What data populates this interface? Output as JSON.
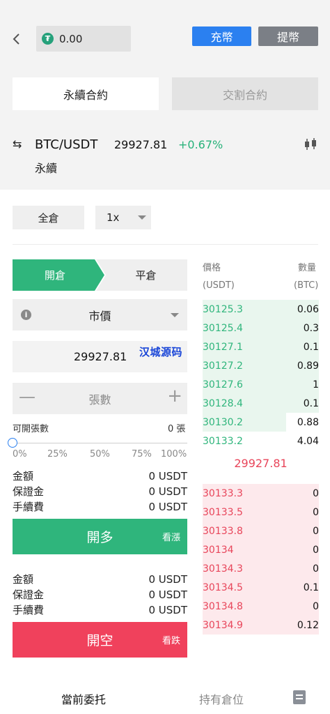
{
  "header": {
    "balance": "0.00",
    "deposit_label": "充幣",
    "withdraw_label": "提幣"
  },
  "contract_tabs": {
    "perpetual": "永續合約",
    "delivery": "交割合約"
  },
  "ticker": {
    "pair": "BTC/USDT",
    "price": "29927.81",
    "change": "+0.67%",
    "sub": "永續"
  },
  "margin": {
    "mode": "全倉",
    "leverage": "1x"
  },
  "order_form": {
    "open_label": "開倉",
    "close_label": "平倉",
    "order_type": "市價",
    "price_value": "29927.81",
    "watermark": "汉城源码",
    "qty_placeholder": "張數",
    "available_label": "可開張數",
    "available_value": "0 張",
    "slider_value": 0,
    "percent_marks": [
      "0%",
      "25%",
      "50%",
      "75%",
      "100%"
    ],
    "long_summary": [
      {
        "label": "金額",
        "value": "0 USDT"
      },
      {
        "label": "保證金",
        "value": "0 USDT"
      },
      {
        "label": "手續費",
        "value": "0 USDT"
      }
    ],
    "long_button": "開多",
    "long_sub": "看漲",
    "short_summary": [
      {
        "label": "金額",
        "value": "0 USDT"
      },
      {
        "label": "保證金",
        "value": "0 USDT"
      },
      {
        "label": "手續費",
        "value": "0 USDT"
      }
    ],
    "short_button": "開空",
    "short_sub": "看跌"
  },
  "orderbook": {
    "price_header": "價格",
    "price_unit": "(USDT)",
    "qty_header": "數量",
    "qty_unit": "(BTC)",
    "bids": [
      {
        "price": "30125.3",
        "qty": "0.06",
        "depth": 1.0
      },
      {
        "price": "30125.4",
        "qty": "0.3",
        "depth": 1.0
      },
      {
        "price": "30127.1",
        "qty": "0.1",
        "depth": 1.0
      },
      {
        "price": "30127.2",
        "qty": "0.89",
        "depth": 1.0
      },
      {
        "price": "30127.6",
        "qty": "1",
        "depth": 1.0
      },
      {
        "price": "30128.4",
        "qty": "0.1",
        "depth": 1.0
      },
      {
        "price": "30130.2",
        "qty": "0.88",
        "depth": 0.72
      },
      {
        "price": "30133.2",
        "qty": "4.04",
        "depth": 0
      }
    ],
    "mid_price": "29927.81",
    "asks": [
      {
        "price": "30133.3",
        "qty": "0",
        "depth": 1.0
      },
      {
        "price": "30133.5",
        "qty": "0",
        "depth": 1.0
      },
      {
        "price": "30133.8",
        "qty": "0",
        "depth": 1.0
      },
      {
        "price": "30134",
        "qty": "0",
        "depth": 1.0
      },
      {
        "price": "30134.3",
        "qty": "0",
        "depth": 1.0
      },
      {
        "price": "30134.5",
        "qty": "0.1",
        "depth": 1.0
      },
      {
        "price": "30134.8",
        "qty": "0",
        "depth": 1.0
      },
      {
        "price": "30134.9",
        "qty": "0.12",
        "depth": 1.0
      }
    ]
  },
  "bottom_tabs": {
    "current": "當前委托",
    "positions": "持有倉位"
  },
  "colors": {
    "green": "#2fb57c",
    "red": "#f0415c",
    "blue": "#2b80f0"
  }
}
